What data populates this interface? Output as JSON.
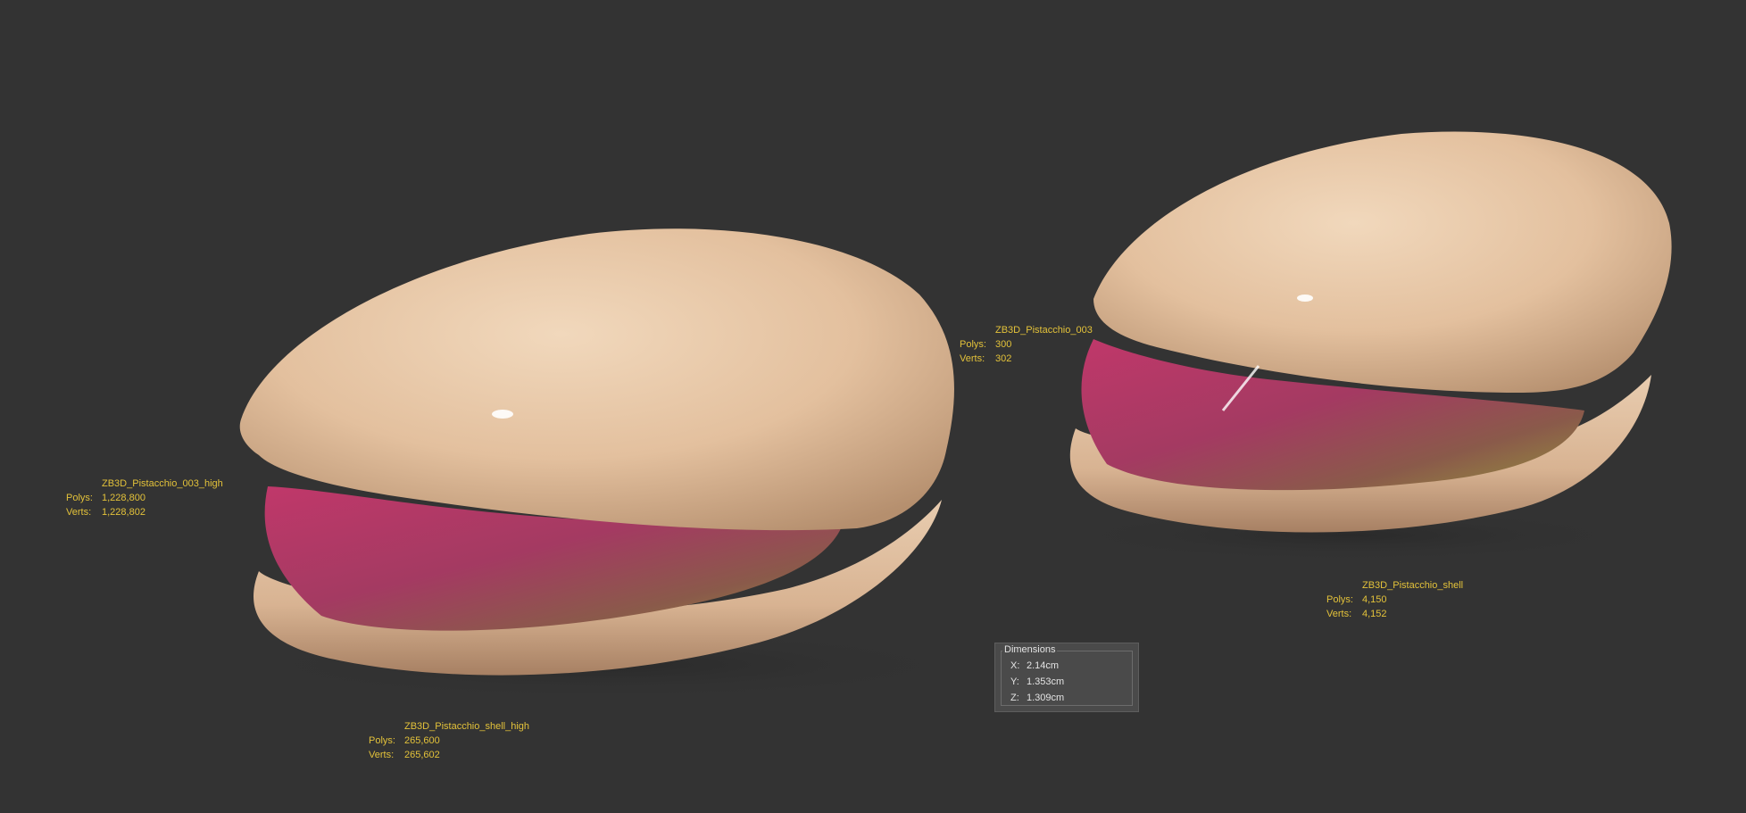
{
  "viewport": {
    "background": "#333333",
    "label_color": "#e3c23a"
  },
  "objects": [
    {
      "id": "pistachio_high",
      "name": "ZB3D_Pistacchio_003_high",
      "polys_label": "Polys:",
      "polys": "1,228,800",
      "verts_label": "Verts:",
      "verts": "1,228,802"
    },
    {
      "id": "shell_high",
      "name": "ZB3D_Pistacchio_shell_high",
      "polys_label": "Polys:",
      "polys": "265,600",
      "verts_label": "Verts:",
      "verts": "265,602"
    },
    {
      "id": "pistachio_low",
      "name": "ZB3D_Pistacchio_003",
      "polys_label": "Polys:",
      "polys": "300",
      "verts_label": "Verts:",
      "verts": "302"
    },
    {
      "id": "shell_low",
      "name": "ZB3D_Pistacchio_shell",
      "polys_label": "Polys:",
      "polys": "4,150",
      "verts_label": "Verts:",
      "verts": "4,152"
    }
  ],
  "dimensions": {
    "title": "Dimensions",
    "x_label": "X:",
    "x": "2.14cm",
    "y_label": "Y:",
    "y": "1.353cm",
    "z_label": "Z:",
    "z": "1.309cm"
  }
}
